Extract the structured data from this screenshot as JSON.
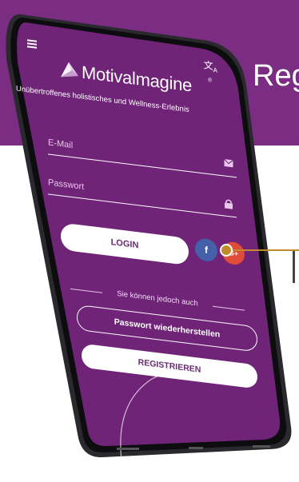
{
  "background": {
    "title": "Reg",
    "band_color": "#7a2d83",
    "accent_color": "#c08b2c"
  },
  "app": {
    "menu_icon": "hamburger-icon",
    "language_icon": "translate-icon",
    "logo_text": "Motivalmagine",
    "logo_mark": "®",
    "tagline": "Unübertroffenes holistisches und Wellness-Erlebnis",
    "email_placeholder": "E-Mail",
    "password_placeholder": "Passwort",
    "login_label": "LOGIN",
    "facebook_label": "f",
    "google_label": "G+",
    "divider_text": "Sie können jedoch auch",
    "reset_label": "Passwort wiederherstellen",
    "register_label": "REGISTRIEREN",
    "screen_color": "#6f2477",
    "facebook_color": "#4460a8",
    "google_color": "#e04c3a"
  }
}
